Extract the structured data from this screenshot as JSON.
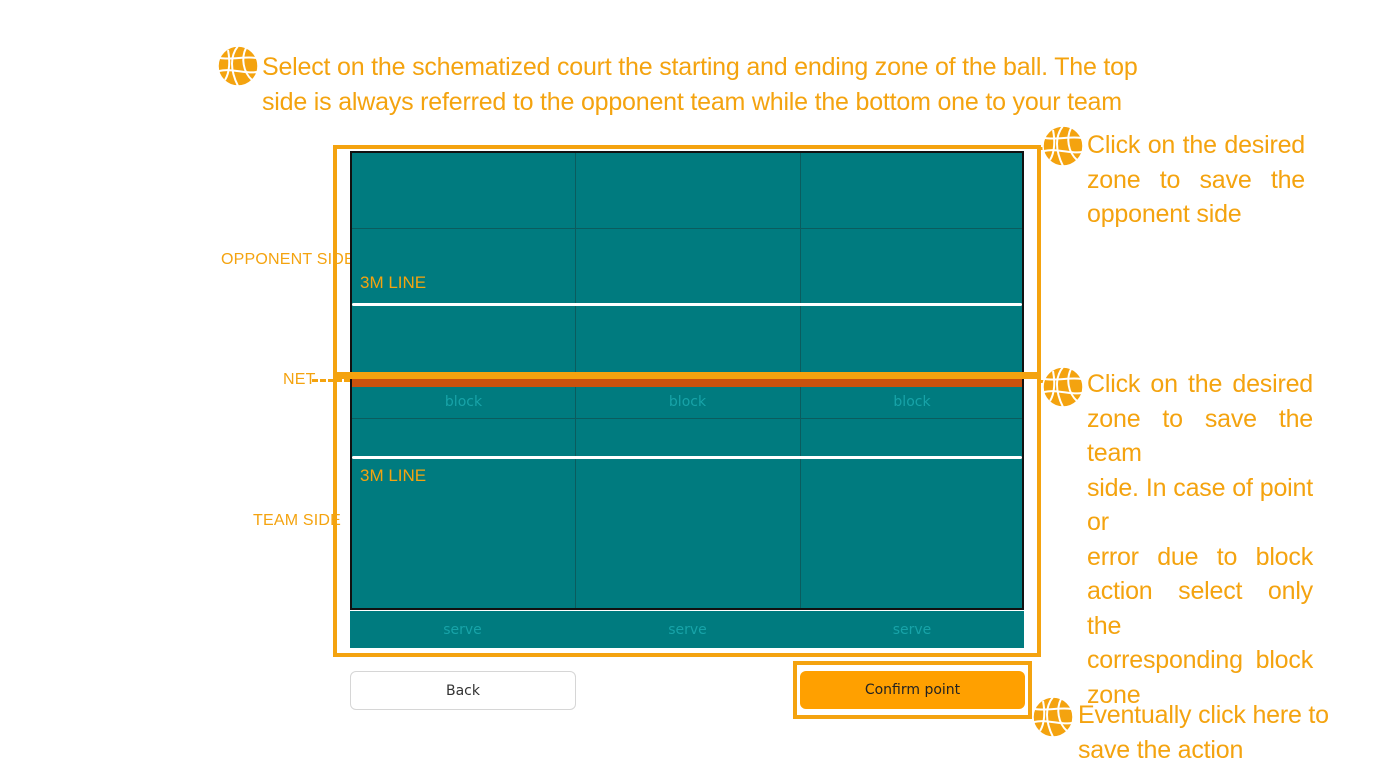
{
  "instructions": {
    "top_line1": "Select on the schematized court the starting and ending zone of the ball. The top",
    "top_line2": "side is always referred to the opponent team while the bottom one to your team",
    "opponent_help": [
      "Click on the desired",
      "zone to save the",
      "opponent side"
    ],
    "team_help": [
      "Click on the desired",
      "zone to save the team",
      "side. In case of point or",
      "error due to block",
      "action select only the",
      "corresponding block",
      "zone"
    ],
    "confirm_help": [
      "Eventually click here to",
      "save the action"
    ]
  },
  "labels": {
    "opponent_side": "OPPONENT SIDE",
    "net": "NET",
    "team_side": "TEAM SIDE",
    "three_m_line": "3M LINE"
  },
  "court": {
    "block_zones": [
      "block",
      "block",
      "block"
    ],
    "serve_zones": [
      "serve",
      "serve",
      "serve"
    ]
  },
  "buttons": {
    "back": "Back",
    "confirm": "Confirm point"
  },
  "colors": {
    "accent": "#f4a30f",
    "court": "#007b7f",
    "net": "#c9520e",
    "confirm_button": "#ffa000"
  },
  "icons": [
    "volleyball-icon"
  ]
}
